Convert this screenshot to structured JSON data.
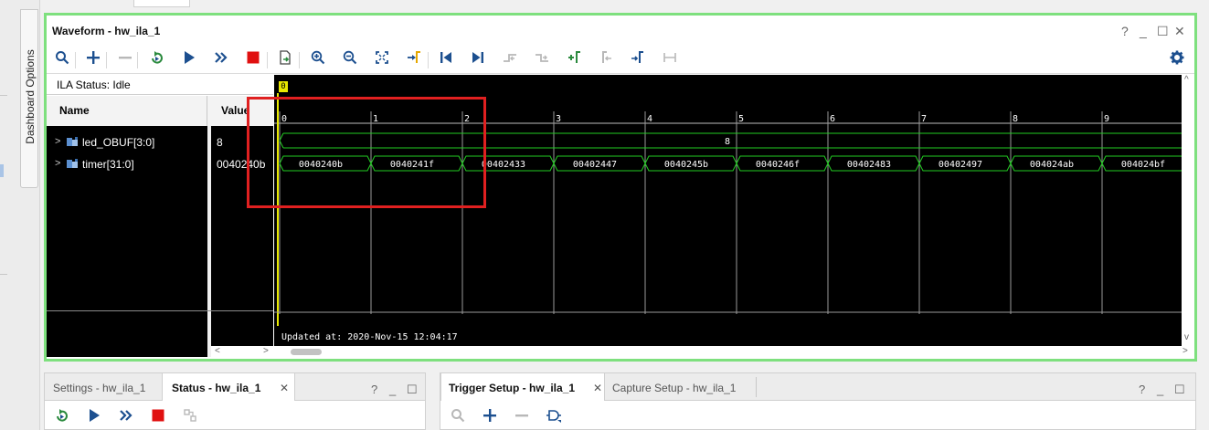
{
  "dashboard_tab": {
    "label": "Dashboard Options"
  },
  "waveform": {
    "title": "Waveform - hw_ila_1",
    "controls": {
      "help": "?",
      "minimize": "_",
      "maximize": "☐",
      "close": "✕"
    },
    "toolbar": {
      "search": "search-icon",
      "add": "plus-icon",
      "remove": "minus-icon",
      "icons": [
        "search",
        "add",
        "remove",
        "run-trigger-immediate",
        "run",
        "auto-run",
        "stop",
        "export",
        "zoom-in",
        "zoom-out",
        "zoom-fit",
        "go-to-cursor",
        "go-to-start",
        "go-to-end",
        "prev-transition",
        "next-transition",
        "add-marker",
        "prev-marker",
        "next-marker",
        "swap-cursors",
        "settings"
      ]
    },
    "ila_status": "ILA Status: Idle",
    "columns": {
      "name": "Name",
      "value": "Value"
    },
    "signals": [
      {
        "name": "led_OBUF[3:0]",
        "value": "8"
      },
      {
        "name": "timer[31:0]",
        "value": "0040240b"
      }
    ],
    "cursor_label": "0",
    "time_ticks": [
      "0",
      "1",
      "2",
      "3",
      "4",
      "5",
      "6",
      "7",
      "8",
      "9"
    ],
    "led_segments": [
      "8"
    ],
    "timer_segments": [
      "0040240b",
      "0040241f",
      "00402433",
      "00402447",
      "0040245b",
      "0040246f",
      "00402483",
      "00402497",
      "004024ab",
      "004024bf"
    ],
    "updated_at": "Updated at: 2020-Nov-15 12:04:17",
    "scroll": {
      "left": "<",
      "right": ">",
      "up": "^",
      "down": "v"
    }
  },
  "settings_panel": {
    "tabs": [
      {
        "label": "Settings - hw_ila_1",
        "active": false
      },
      {
        "label": "Status - hw_ila_1",
        "active": true
      }
    ],
    "close": "✕",
    "controls": {
      "help": "?",
      "minimize": "_",
      "maximize": "☐"
    }
  },
  "trigger_panel": {
    "tabs": [
      {
        "label": "Trigger Setup - hw_ila_1",
        "active": true
      },
      {
        "label": "Capture Setup - hw_ila_1",
        "active": false
      }
    ],
    "close": "✕",
    "controls": {
      "help": "?",
      "minimize": "_",
      "maximize": "☐"
    }
  },
  "colors": {
    "window_highlight": "#7ee07e",
    "waveform_bg": "#000000",
    "signal_green": "#22cc22",
    "cursor_yellow": "#e8e800",
    "annotation_red": "#e02020",
    "accent_blue": "#1c4f8f"
  }
}
